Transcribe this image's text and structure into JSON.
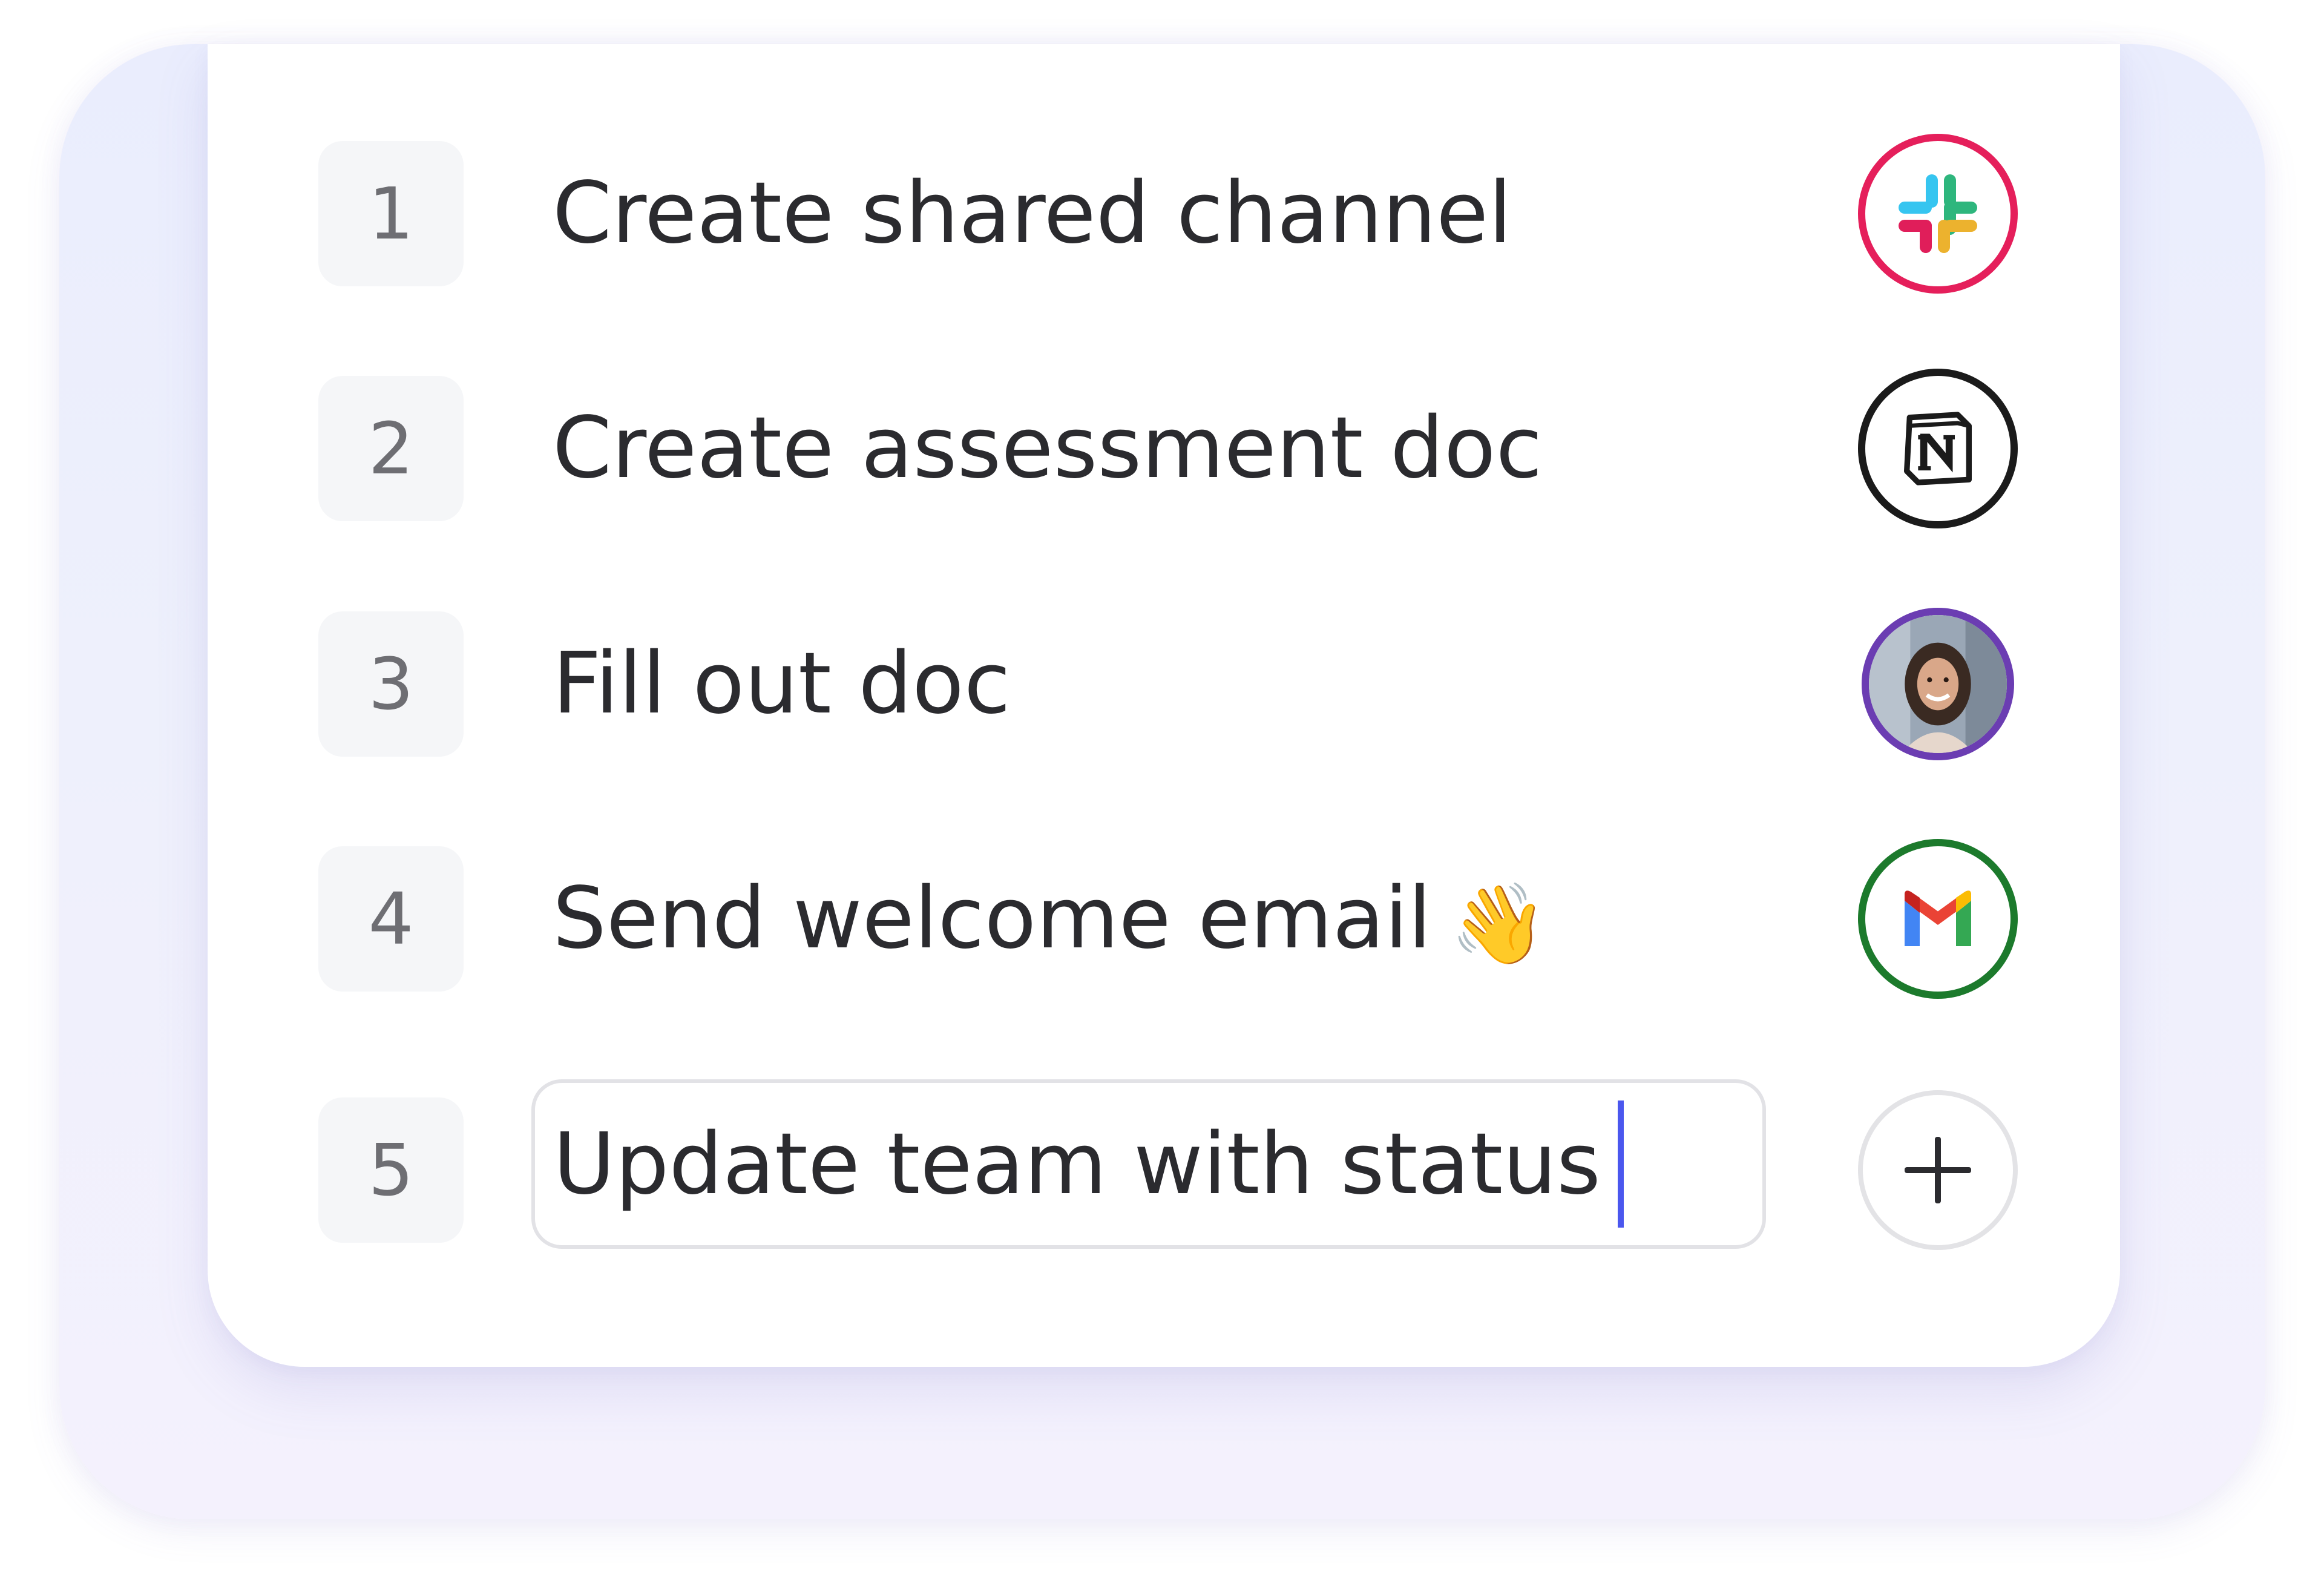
{
  "checklist": {
    "items": [
      {
        "number": "1",
        "label": "Create shared channel",
        "app_icon": "slack-icon",
        "ring_color": "#e51f5b"
      },
      {
        "number": "2",
        "label": "Create assessment doc",
        "app_icon": "notion-icon",
        "ring_color": "#1b1b1b"
      },
      {
        "number": "3",
        "label": "Fill out doc",
        "app_icon": "person-avatar",
        "ring_color": "#6b3db2"
      },
      {
        "number": "4",
        "label": "Send welcome email",
        "emoji": "👋",
        "app_icon": "gmail-icon",
        "ring_color": "#1c7a2c"
      }
    ],
    "new_item": {
      "number": "5",
      "value": "Update team with status",
      "add_icon": "plus-icon"
    }
  },
  "colors": {
    "caret": "#4b57ee",
    "number_box": "#f5f6f8",
    "outer_background": "#eceefd"
  }
}
